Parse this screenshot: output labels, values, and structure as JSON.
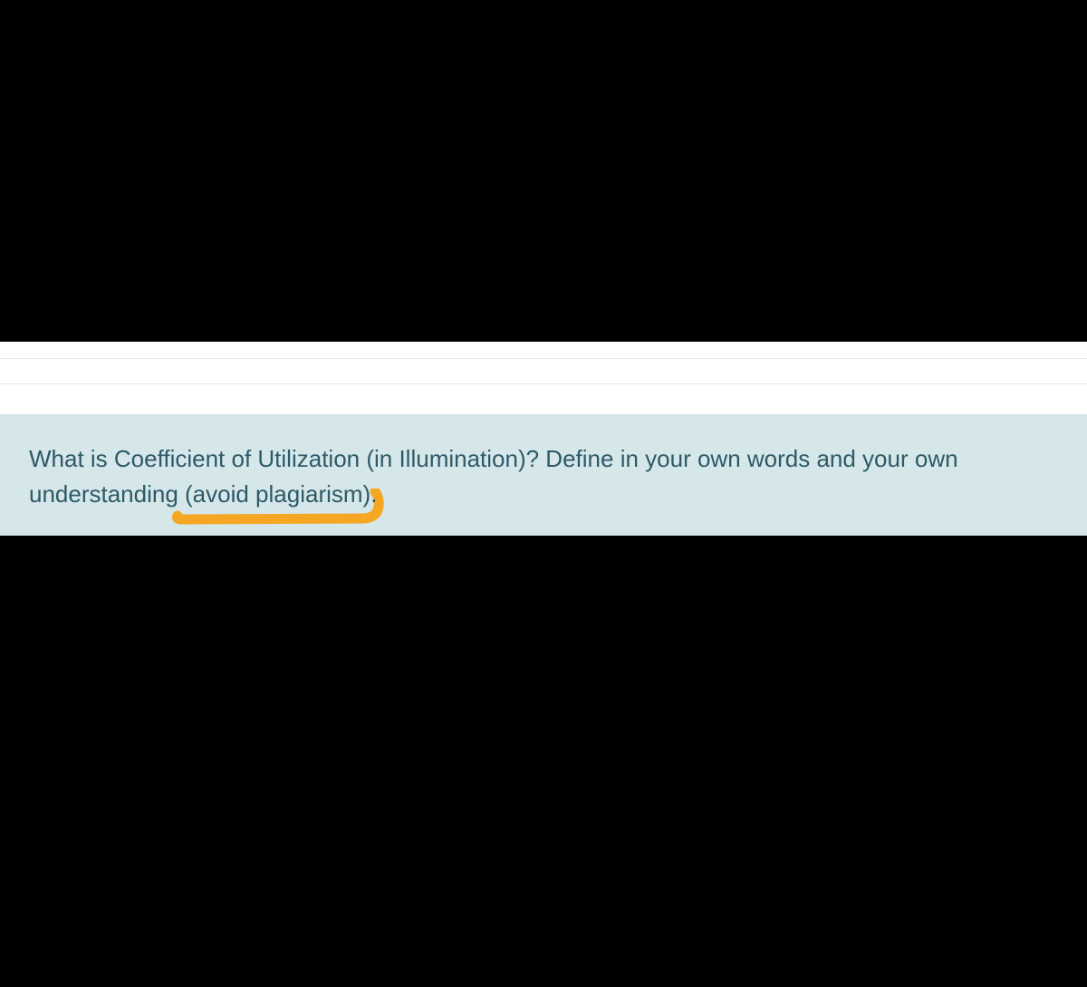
{
  "question": {
    "text": "What is Coefficient of Utilization (in Illumination)? Define in your own words and your own understanding (avoid plagiarism)."
  },
  "colors": {
    "questionBg": "#d5e7e9",
    "questionText": "#2d5968",
    "highlightColor": "#f5a623"
  }
}
